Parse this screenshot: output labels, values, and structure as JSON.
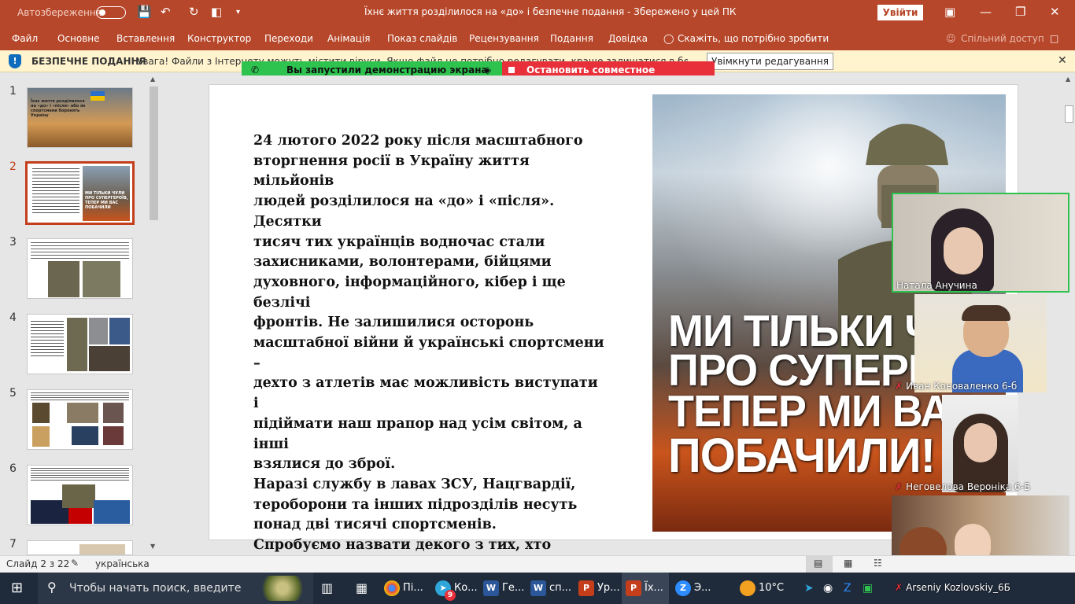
{
  "titlebar": {
    "autosave_label": "Автозбереження",
    "doc_title": "Їхнє життя розділилося на «до» і  безпечне подання  -  Збережено у цей ПК",
    "signin_label": "Увійти"
  },
  "menu": [
    "Файл",
    "Основне",
    "Вставлення",
    "Конструктор",
    "Переходи",
    "Анімація",
    "Показ слайдів",
    "Рецензування",
    "Подання",
    "Довідка"
  ],
  "tell_me": "Скажіть, що потрібно зробити",
  "share_label": "Спільний доступ",
  "infobar": {
    "label": "БЕЗПЕЧНЕ ПОДАННЯ",
    "message": "Увага! Файли з Інтернету можуть містити віруси. Якщо файл не потрібно редагувати, краще залишатися в безпечному поданні.",
    "enable_button": "Увімкнути редагування"
  },
  "screenshare": {
    "active_text": "Вы запустили демонстрацию экрана",
    "stop_text": "Остановить совместное использование"
  },
  "thumbnails": [
    {
      "num": "1",
      "text": "Їхнє життя розділилося на «до» і «після» або як спортсмени боронять Україну"
    },
    {
      "num": "2",
      "text": "МИ ТІЛЬКИ ЧУЛИ ПРО СУПЕРГЕРОЇВ, ТЕПЕР МИ ВАС ПОБАЧИЛИ"
    },
    {
      "num": "3",
      "text": ""
    },
    {
      "num": "4",
      "text": ""
    },
    {
      "num": "5",
      "text": ""
    },
    {
      "num": "6",
      "text": ""
    },
    {
      "num": "7",
      "text": ""
    }
  ],
  "slide": {
    "paragraphs": [
      "24 лютого 2022 року після масштабного\nвторгнення росії в Україну життя мільйонів\nлюдей  розділилося на «до» і «після». Десятки\nтисяч тих українців водночас стали\nзахисниками, волонтерами, бійцями\nдуховного, інформаційного, кібер і ще безлічі\nфронтів. Не залишилися осторонь\nмасштабної війни й українські спортсмени –\nдехто з атлетів має можливість виступати і\nпідіймати наш прапор над усім світом, а інші\nвзялися до зброї.",
      "Наразі службу в лавах ЗСУ, Нацгвардії,\nтероборони та інших підрозділів несуть\nпонад дві тисячі спортсменів.",
      "Спробуємо назвати декого з тих, хто\nборонить Україну в складі сил спротиву,\nадже впевнені, що таких спортсменів\nнабагато більше."
    ],
    "poster_lines": [
      "МИ ТІЛЬКИ ЧУЛИ",
      "ПРО СУПЕРГЕРОЇВ,",
      "ТЕПЕР МИ ВАС",
      "ПОБАЧИЛИ!"
    ]
  },
  "participants": [
    {
      "name": "Натала Анучина",
      "muted": false
    },
    {
      "name": "Иван Коноваленко 6-б",
      "muted": true
    },
    {
      "name": "Неговелова Вероніка 6-Б",
      "muted": true
    },
    {
      "name": "Arseniy Kozlovskiy_6Б",
      "muted": true
    }
  ],
  "status": {
    "slide_counter": "Слайд 2 з 22",
    "language": "українська"
  },
  "taskbar": {
    "search_placeholder": "Чтобы начать поиск, введите",
    "apps": [
      {
        "label": "Пі...",
        "icon": "chrome-icon"
      },
      {
        "label": "Ко...",
        "icon": "telegram-icon"
      },
      {
        "label": "Ге...",
        "icon": "word-icon"
      },
      {
        "label": "сп...",
        "icon": "word-icon"
      },
      {
        "label": "Ур...",
        "icon": "powerpoint-icon"
      },
      {
        "label": "Їх...",
        "icon": "powerpoint-icon"
      },
      {
        "label": "Э...",
        "icon": "zoom-icon"
      }
    ],
    "weather": "10°C",
    "telegram_badge": "9"
  },
  "colors": {
    "accent": "#b7472a",
    "info_bg": "#fff4ce",
    "share_green": "#2ec24f",
    "share_red": "#e8303a",
    "taskbar": "#1f2a3a"
  }
}
